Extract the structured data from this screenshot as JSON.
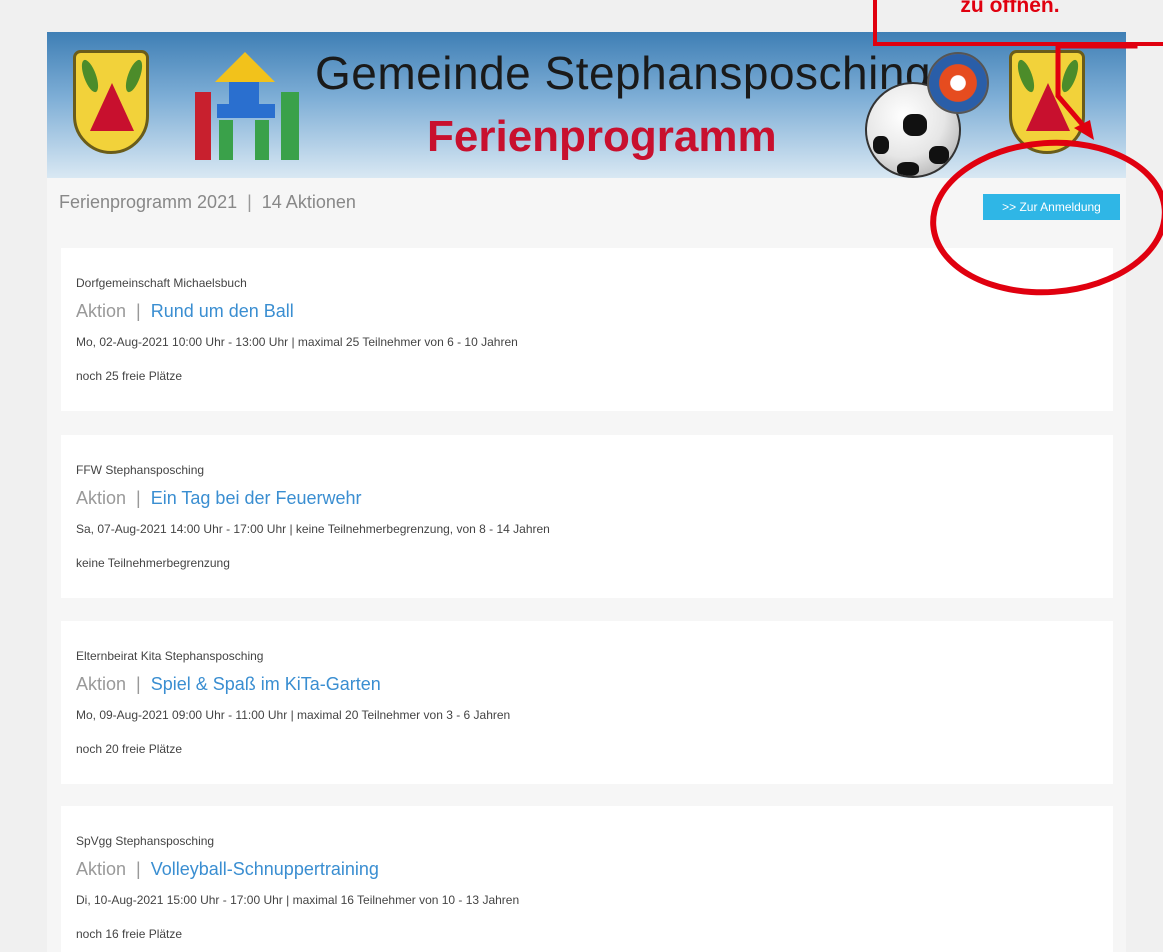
{
  "annotation": {
    "text": "zu öffnen."
  },
  "banner": {
    "title": "Gemeinde Stephansposching",
    "subtitle": "Ferienprogramm"
  },
  "header": {
    "program": "Ferienprogramm 2021",
    "separator": "|",
    "count": "14 Aktionen",
    "register_button": ">> Zur Anmeldung"
  },
  "events": [
    {
      "org": "Dorfgemeinschaft Michaelsbuch",
      "type": "Aktion",
      "sep": "|",
      "title": "Rund um den Ball",
      "details": "Mo, 02-Aug-2021 10:00 Uhr - 13:00 Uhr | maximal 25 Teilnehmer von 6 - 10 Jahren",
      "status": "noch 25 freie Plätze"
    },
    {
      "org": "FFW Stephansposching",
      "type": "Aktion",
      "sep": "|",
      "title": "Ein Tag bei der Feuerwehr",
      "details": "Sa, 07-Aug-2021 14:00 Uhr - 17:00 Uhr | keine Teilnehmerbegrenzung, von 8 - 14 Jahren",
      "status": "keine Teilnehmerbegrenzung"
    },
    {
      "org": "Elternbeirat Kita Stephansposching",
      "type": "Aktion",
      "sep": "|",
      "title": "Spiel & Spaß im KiTa-Garten",
      "details": "Mo, 09-Aug-2021 09:00 Uhr - 11:00 Uhr | maximal 20 Teilnehmer von 3 - 6 Jahren",
      "status": "noch 20 freie Plätze"
    },
    {
      "org": "SpVgg Stephansposching",
      "type": "Aktion",
      "sep": "|",
      "title": "Volleyball-Schnuppertraining",
      "details": "Di, 10-Aug-2021 15:00 Uhr - 17:00 Uhr | maximal 16 Teilnehmer von 10 - 13 Jahren",
      "status": "noch 16 freie Plätze"
    }
  ]
}
